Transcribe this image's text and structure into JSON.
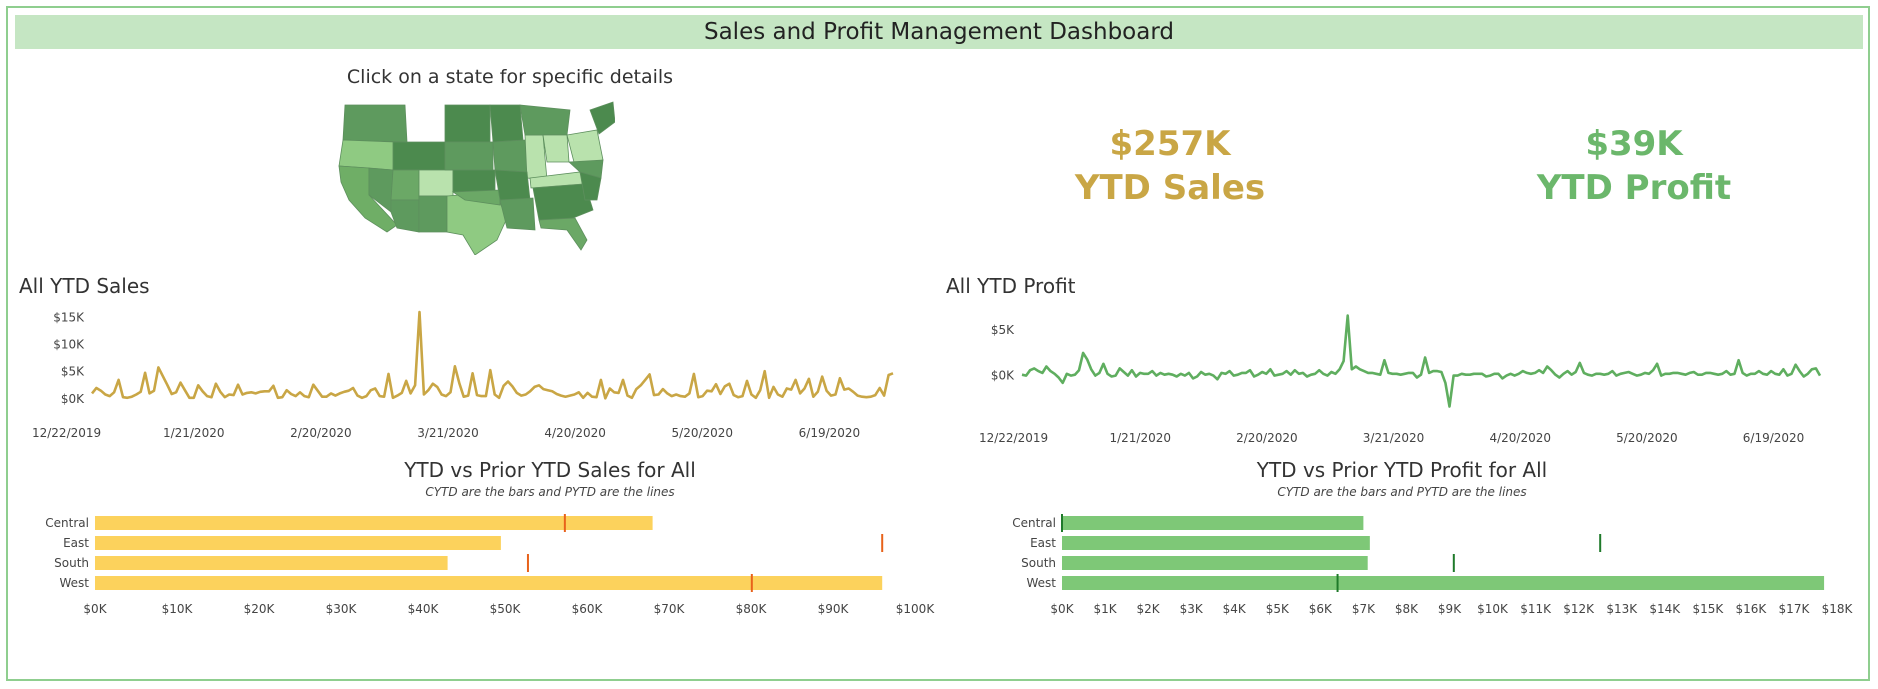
{
  "dashboard": {
    "title": "Sales and Profit Management Dashboard"
  },
  "map": {
    "caption": "Click on a state for specific details"
  },
  "kpis": {
    "sales": {
      "value": "$257K",
      "label": "YTD Sales"
    },
    "profit": {
      "value": "$39K",
      "label": "YTD Profit"
    }
  },
  "colors": {
    "sales_line": "#c9a645",
    "profit_line": "#5fae5f",
    "sales_bar": "#fcd25c",
    "sales_ref": "#e8621a",
    "profit_bar": "#7ec877",
    "profit_ref": "#1f7a2a",
    "title_bg": "#c5e6c3",
    "border": "#8fce8f"
  },
  "chart_data": [
    {
      "type": "line",
      "title": "All YTD Sales",
      "x_tick_labels": [
        "12/22/2019",
        "1/21/2020",
        "2/20/2020",
        "3/21/2020",
        "4/20/2020",
        "5/20/2020",
        "6/19/2020"
      ],
      "y_tick_labels": [
        "$15K",
        "$10K",
        "$5K",
        "$0K"
      ],
      "y_ticks": [
        15000,
        10000,
        5000,
        0
      ],
      "ylim": [
        -1500,
        16000
      ],
      "x_start": "2019-12-28",
      "x_end": "2020-07-04",
      "tick_dates": [
        "2019-12-22",
        "2020-01-21",
        "2020-02-20",
        "2020-03-21",
        "2020-04-20",
        "2020-05-20",
        "2020-06-19"
      ],
      "values": [
        1000,
        2000,
        1500,
        800,
        500,
        1200,
        3500,
        300,
        200,
        400,
        800,
        1300,
        4800,
        1000,
        1500,
        5800,
        4200,
        2600,
        900,
        1200,
        3000,
        1600,
        200,
        200,
        2500,
        1400,
        500,
        300,
        2800,
        1300,
        300,
        800,
        700,
        2600,
        800,
        1100,
        1200,
        1000,
        1300,
        1400,
        1400,
        2400,
        200,
        300,
        1600,
        900,
        500,
        1200,
        500,
        300,
        2600,
        1500,
        400,
        400,
        1000,
        600,
        1000,
        1300,
        1500,
        2000,
        600,
        200,
        500,
        1600,
        1900,
        500,
        400,
        4600,
        200,
        600,
        1100,
        3300,
        1000,
        2500,
        16000,
        800,
        1600,
        2800,
        2200,
        800,
        500,
        1200,
        6000,
        2900,
        400,
        600,
        4700,
        700,
        500,
        500,
        5300,
        800,
        200,
        2400,
        3200,
        2300,
        1100,
        600,
        800,
        1400,
        2200,
        2500,
        1800,
        1600,
        1400,
        900,
        600,
        400,
        600,
        800,
        1200,
        200,
        1100,
        400,
        300,
        3500,
        100,
        1900,
        1200,
        1100,
        3500,
        600,
        200,
        1800,
        2500,
        3500,
        4500,
        700,
        800,
        1800,
        1000,
        500,
        800,
        500,
        400,
        1000,
        4600,
        300,
        500,
        1500,
        1400,
        2700,
        900,
        2300,
        2800,
        700,
        300,
        500,
        3300,
        800,
        200,
        1600,
        5100,
        200,
        2200,
        800,
        400,
        1900,
        1700,
        3500,
        1000,
        1900,
        3700,
        400,
        1300,
        4100,
        1500,
        600,
        800,
        3800,
        1700,
        1900,
        1300,
        600,
        400,
        300,
        400,
        700,
        2000,
        600,
        4400,
        4700
      ]
    },
    {
      "type": "line",
      "title": "All YTD Profit",
      "x_tick_labels": [
        "12/22/2019",
        "1/21/2020",
        "2/20/2020",
        "3/21/2020",
        "4/20/2020",
        "5/20/2020",
        "6/19/2020"
      ],
      "y_tick_labels": [
        "$5K",
        "$0K"
      ],
      "y_ticks": [
        5000,
        0
      ],
      "ylim": [
        -4000,
        7000
      ],
      "x_start": "2019-12-24",
      "x_end": "2020-06-30",
      "tick_dates": [
        "2019-12-22",
        "2020-01-21",
        "2020-02-20",
        "2020-03-21",
        "2020-04-20",
        "2020-05-20",
        "2020-06-19"
      ],
      "values": [
        100,
        0,
        600,
        800,
        500,
        300,
        1000,
        500,
        200,
        -200,
        -800,
        200,
        0,
        100,
        600,
        2500,
        1800,
        700,
        0,
        300,
        1300,
        200,
        -100,
        0,
        800,
        400,
        0,
        600,
        -100,
        300,
        200,
        200,
        500,
        0,
        300,
        100,
        200,
        100,
        -100,
        200,
        0,
        300,
        -300,
        -100,
        400,
        100,
        200,
        0,
        -400,
        300,
        200,
        500,
        0,
        100,
        300,
        300,
        600,
        -100,
        100,
        400,
        200,
        700,
        0,
        100,
        200,
        500,
        100,
        600,
        200,
        300,
        -100,
        100,
        200,
        600,
        200,
        0,
        400,
        200,
        700,
        1600,
        6600,
        700,
        1000,
        700,
        500,
        300,
        300,
        200,
        100,
        1700,
        300,
        200,
        200,
        100,
        200,
        300,
        300,
        -200,
        100,
        2000,
        300,
        500,
        500,
        400,
        -800,
        -3400,
        0,
        0,
        200,
        100,
        100,
        200,
        200,
        200,
        -100,
        0,
        200,
        200,
        -300,
        0,
        200,
        0,
        200,
        500,
        300,
        200,
        300,
        600,
        300,
        1000,
        600,
        100,
        -200,
        200,
        500,
        100,
        400,
        1400,
        300,
        100,
        0,
        200,
        200,
        100,
        200,
        500,
        0,
        200,
        300,
        400,
        200,
        0,
        100,
        300,
        200,
        600,
        1300,
        0,
        200,
        200,
        300,
        300,
        200,
        100,
        300,
        400,
        100,
        100,
        300,
        300,
        200,
        100,
        200,
        500,
        100,
        200,
        1700,
        300,
        0,
        200,
        200,
        500,
        200,
        100,
        500,
        200,
        100,
        700,
        0,
        200,
        1200,
        500,
        -100,
        200,
        700,
        800,
        0
      ]
    },
    {
      "type": "bar",
      "title": "YTD vs Prior YTD Sales for All",
      "subtitle": "CYTD are the bars and PYTD are the lines",
      "categories": [
        "Central",
        "East",
        "South",
        "West"
      ],
      "series": [
        {
          "name": "CYTD",
          "values": [
            68000,
            49500,
            43000,
            96000
          ]
        },
        {
          "name": "PYTD",
          "values": [
            57300,
            96000,
            52800,
            80100
          ]
        }
      ],
      "x_tick_labels": [
        "$0K",
        "$10K",
        "$20K",
        "$30K",
        "$40K",
        "$50K",
        "$60K",
        "$70K",
        "$80K",
        "$90K",
        "$100K"
      ],
      "xlim": [
        0,
        100000
      ]
    },
    {
      "type": "bar",
      "title": "YTD vs Prior YTD Profit for All",
      "subtitle": "CYTD are the bars and PYTD are the lines",
      "categories": [
        "Central",
        "East",
        "South",
        "West"
      ],
      "series": [
        {
          "name": "CYTD",
          "values": [
            7000,
            7150,
            7100,
            17700
          ]
        },
        {
          "name": "PYTD",
          "values": [
            0,
            12500,
            9100,
            6400
          ]
        }
      ],
      "x_tick_labels": [
        "$0K",
        "$1K",
        "$2K",
        "$3K",
        "$4K",
        "$5K",
        "$6K",
        "$7K",
        "$8K",
        "$9K",
        "$10K",
        "$11K",
        "$12K",
        "$13K",
        "$14K",
        "$15K",
        "$16K",
        "$17K",
        "$18K"
      ],
      "xlim": [
        0,
        18000
      ]
    }
  ]
}
